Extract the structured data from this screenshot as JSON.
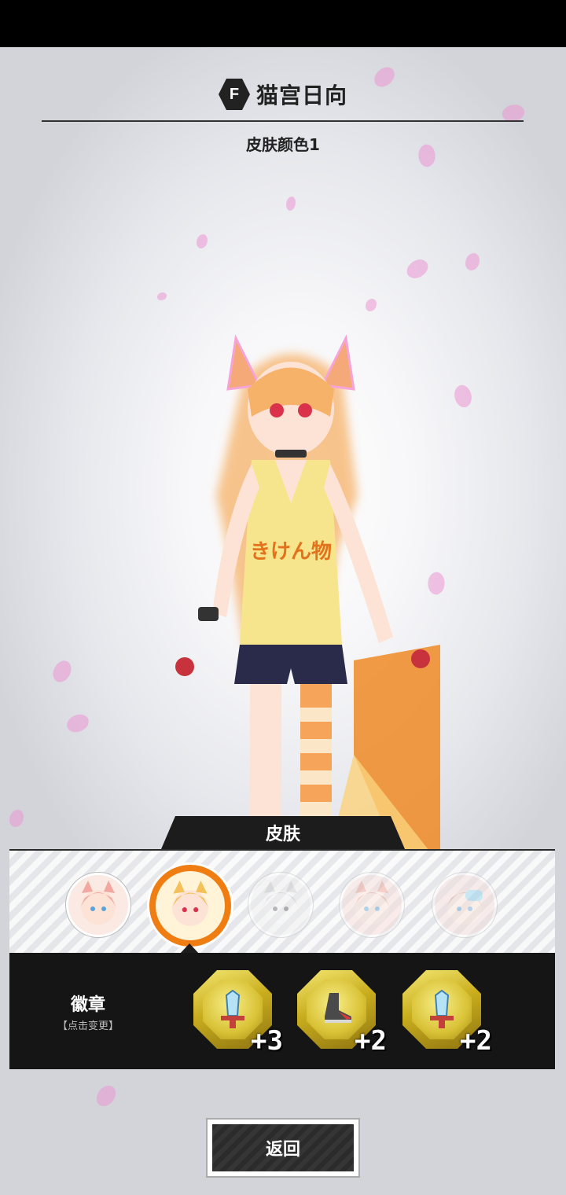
{
  "header": {
    "brand_icon": "F",
    "character_name": "猫宫日向",
    "skin_name": "皮肤颜色1"
  },
  "character": {
    "shirt_text": "きけん物"
  },
  "skin_panel": {
    "tab_label": "皮肤",
    "skins": [
      {
        "name": "skin-pink",
        "hair": "#f2a8a0",
        "selected": false,
        "dim": false
      },
      {
        "name": "skin-yellow",
        "hair": "#f3c05a",
        "selected": true,
        "dim": false
      },
      {
        "name": "skin-white",
        "hair": "#e5e5e5",
        "selected": false,
        "dim": true
      },
      {
        "name": "skin-red",
        "hair": "#ee9c8e",
        "selected": false,
        "dim": true
      },
      {
        "name": "skin-blue-goggles",
        "hair": "#e8a89a",
        "selected": false,
        "dim": true
      }
    ]
  },
  "badges": {
    "label": "徽章",
    "sublabel": "【点击变更】",
    "items": [
      {
        "icon": "sword-icon",
        "value": "+3"
      },
      {
        "icon": "boot-icon",
        "value": "+2"
      },
      {
        "icon": "sword-icon",
        "value": "+2"
      }
    ]
  },
  "footer": {
    "back_label": "返回"
  },
  "colors": {
    "accent": "#f07d12",
    "panel": "#151515",
    "badge_gold": "#d9c236"
  }
}
